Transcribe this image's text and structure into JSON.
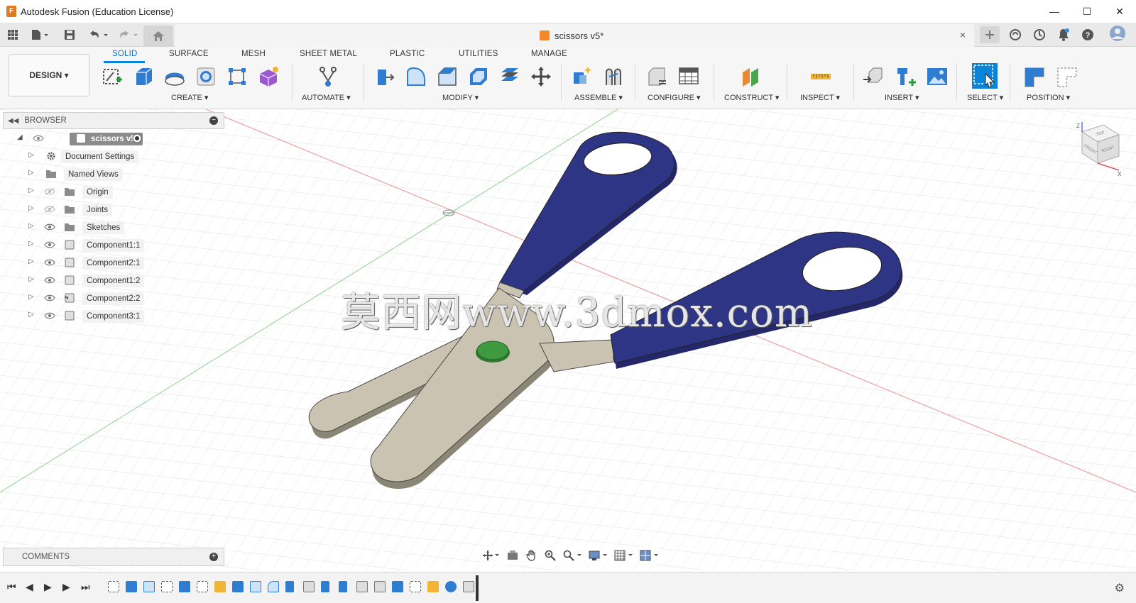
{
  "window": {
    "title": "Autodesk Fusion (Education License)",
    "controls": {
      "minimize": "—",
      "maximize": "☐",
      "close": "✕"
    }
  },
  "tabs": {
    "document_tab": "scissors v5*",
    "close_glyph": "×"
  },
  "ribbon": {
    "workspace_button": "DESIGN ▾",
    "tabs": [
      "SOLID",
      "SURFACE",
      "MESH",
      "SHEET METAL",
      "PLASTIC",
      "UTILITIES",
      "MANAGE"
    ],
    "active_tab": "SOLID",
    "groups": {
      "create": "CREATE ▾",
      "automate": "AUTOMATE ▾",
      "modify": "MODIFY ▾",
      "assemble": "ASSEMBLE ▾",
      "configure": "CONFIGURE ▾",
      "construct": "CONSTRUCT ▾",
      "inspect": "INSPECT ▾",
      "insert": "INSERT ▾",
      "select": "SELECT ▾",
      "position": "POSITION ▾"
    }
  },
  "browser": {
    "header": "BROWSER",
    "root": "scissors v5",
    "items": [
      {
        "label": "Document Settings",
        "icon": "gear-icon"
      },
      {
        "label": "Named Views",
        "icon": "folder-icon"
      },
      {
        "label": "Origin",
        "icon": "folder-icon"
      },
      {
        "label": "Joints",
        "icon": "folder-icon"
      },
      {
        "label": "Sketches",
        "icon": "folder-icon"
      },
      {
        "label": "Component1:1",
        "icon": "component-icon"
      },
      {
        "label": "Component2:1",
        "icon": "component-icon"
      },
      {
        "label": "Component1:2",
        "icon": "component-icon"
      },
      {
        "label": "Component2:2",
        "icon": "component-icon"
      },
      {
        "label": "Component3:1",
        "icon": "component-icon"
      }
    ]
  },
  "viewcube": {
    "top": "TOP",
    "front": "FRONT",
    "right": "RIGHT",
    "z": "Z",
    "x": "X"
  },
  "comments": {
    "label": "COMMENTS"
  },
  "watermark": "莫西网www.3dmox.com",
  "colors": {
    "accent": "#0a84d6",
    "handle": "#2f3585",
    "blade": "#cbc3b1",
    "pivot": "#3f9a3f"
  }
}
